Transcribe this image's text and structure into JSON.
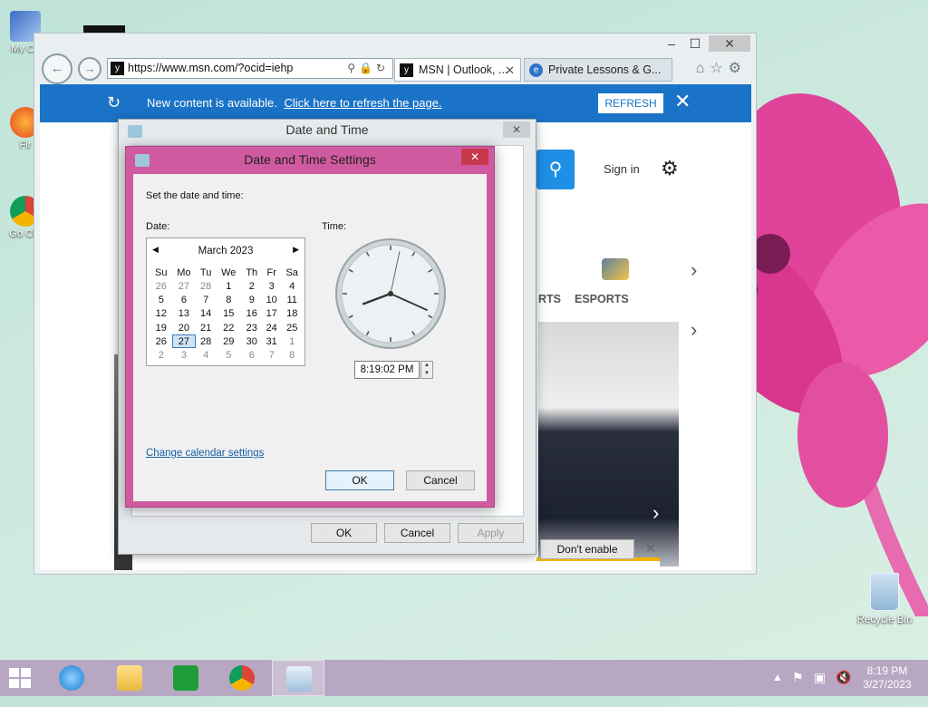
{
  "desktop": {
    "icons": [
      {
        "label": "My Co"
      },
      {
        "label": "Fir"
      },
      {
        "label": "Go Chr"
      }
    ],
    "recycle_bin": "Recycle Bin"
  },
  "browser": {
    "address": "https://www.msn.com/?ocid=iehp",
    "tabs": [
      {
        "label": "MSN | Outlook, ...",
        "close": "✕"
      },
      {
        "label": "Private Lessons & G...",
        "close": ""
      }
    ],
    "notification": {
      "message": "New content is available.",
      "link": "Click here to refresh the page.",
      "button": "REFRESH"
    },
    "page": {
      "signin": "Sign in",
      "nav_item": "ESPORTS",
      "nav_partial": "RTS",
      "dont_enable": "Don't enable"
    }
  },
  "date_time_dialog": {
    "title": "Date and Time",
    "buttons": {
      "ok": "OK",
      "cancel": "Cancel",
      "apply": "Apply"
    }
  },
  "settings_dialog": {
    "title": "Date and Time Settings",
    "heading": "Set the date and time:",
    "date_label": "Date:",
    "time_label": "Time:",
    "calendar": {
      "month": "March 2023",
      "weekdays": [
        "Su",
        "Mo",
        "Tu",
        "We",
        "Th",
        "Fr",
        "Sa"
      ],
      "weeks": [
        [
          "26",
          "27",
          "28",
          "1",
          "2",
          "3",
          "4"
        ],
        [
          "5",
          "6",
          "7",
          "8",
          "9",
          "10",
          "11"
        ],
        [
          "12",
          "13",
          "14",
          "15",
          "16",
          "17",
          "18"
        ],
        [
          "19",
          "20",
          "21",
          "22",
          "23",
          "24",
          "25"
        ],
        [
          "26",
          "27",
          "28",
          "29",
          "30",
          "31",
          "1"
        ],
        [
          "2",
          "3",
          "4",
          "5",
          "6",
          "7",
          "8"
        ]
      ],
      "selected": "27"
    },
    "time_value": "8:19:02 PM",
    "clock": {
      "hour": 8,
      "minute": 19,
      "second": 2
    },
    "change_calendar_link": "Change calendar settings",
    "buttons": {
      "ok": "OK",
      "cancel": "Cancel"
    }
  },
  "taskbar": {
    "time": "8:19 PM",
    "date": "3/27/2023"
  }
}
